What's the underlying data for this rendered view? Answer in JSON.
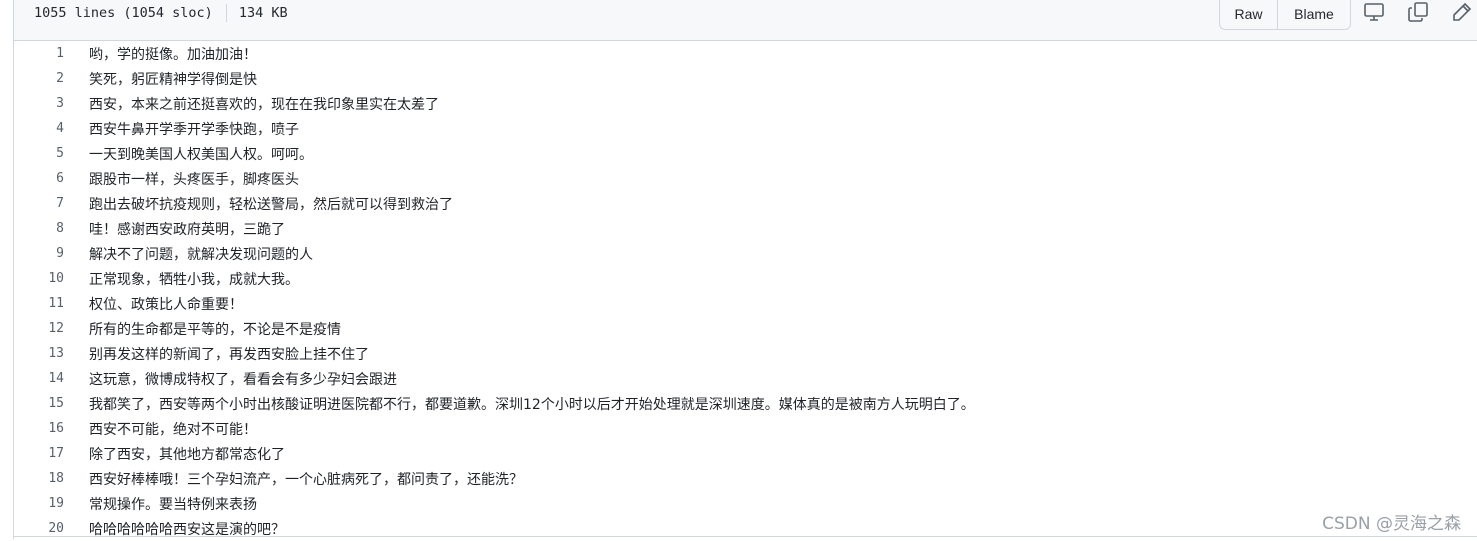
{
  "file_header": {
    "lines_info": "1055 lines (1054 sloc)",
    "size": "134 KB",
    "raw_label": "Raw",
    "blame_label": "Blame",
    "icons": [
      "display-icon",
      "copy-icon",
      "pencil-icon"
    ]
  },
  "lines": [
    {
      "num": "1",
      "text": "哟，学的挺像。加油加油！"
    },
    {
      "num": "2",
      "text": "笑死，躬匠精神学得倒是快"
    },
    {
      "num": "3",
      "text": "西安，本来之前还挺喜欢的，现在在我印象里实在太差了"
    },
    {
      "num": "4",
      "text": "西安牛鼻开学季开学季快跑，喷子"
    },
    {
      "num": "5",
      "text": "一天到晚美国人权美国人权。呵呵。"
    },
    {
      "num": "6",
      "text": "跟股市一样，头疼医手，脚疼医头"
    },
    {
      "num": "7",
      "text": "跑出去破坏抗疫规则，轻松送警局，然后就可以得到救治了"
    },
    {
      "num": "8",
      "text": "哇！感谢西安政府英明，三跪了"
    },
    {
      "num": "9",
      "text": "解决不了问题，就解决发现问题的人"
    },
    {
      "num": "10",
      "text": "正常现象，牺牲小我，成就大我。"
    },
    {
      "num": "11",
      "text": "权位、政策比人命重要！"
    },
    {
      "num": "12",
      "text": "所有的生命都是平等的，不论是不是疫情"
    },
    {
      "num": "13",
      "text": "别再发这样的新闻了，再发西安脸上挂不住了"
    },
    {
      "num": "14",
      "text": "这玩意，微博成特权了，看看会有多少孕妇会跟进"
    },
    {
      "num": "15",
      "text": "我都笑了，西安等两个小时出核酸证明进医院都不行，都要道歉。深圳12个小时以后才开始处理就是深圳速度。媒体真的是被南方人玩明白了。"
    },
    {
      "num": "16",
      "text": "西安不可能，绝对不可能！"
    },
    {
      "num": "17",
      "text": "除了西安，其他地方都常态化了"
    },
    {
      "num": "18",
      "text": "西安好棒棒哦！三个孕妇流产，一个心脏病死了，都问责了，还能洗？"
    },
    {
      "num": "19",
      "text": "常规操作。要当特例来表扬"
    },
    {
      "num": "20",
      "text": "哈哈哈哈哈哈西安这是演的吧？"
    }
  ],
  "watermark": "CSDN @灵海之森"
}
